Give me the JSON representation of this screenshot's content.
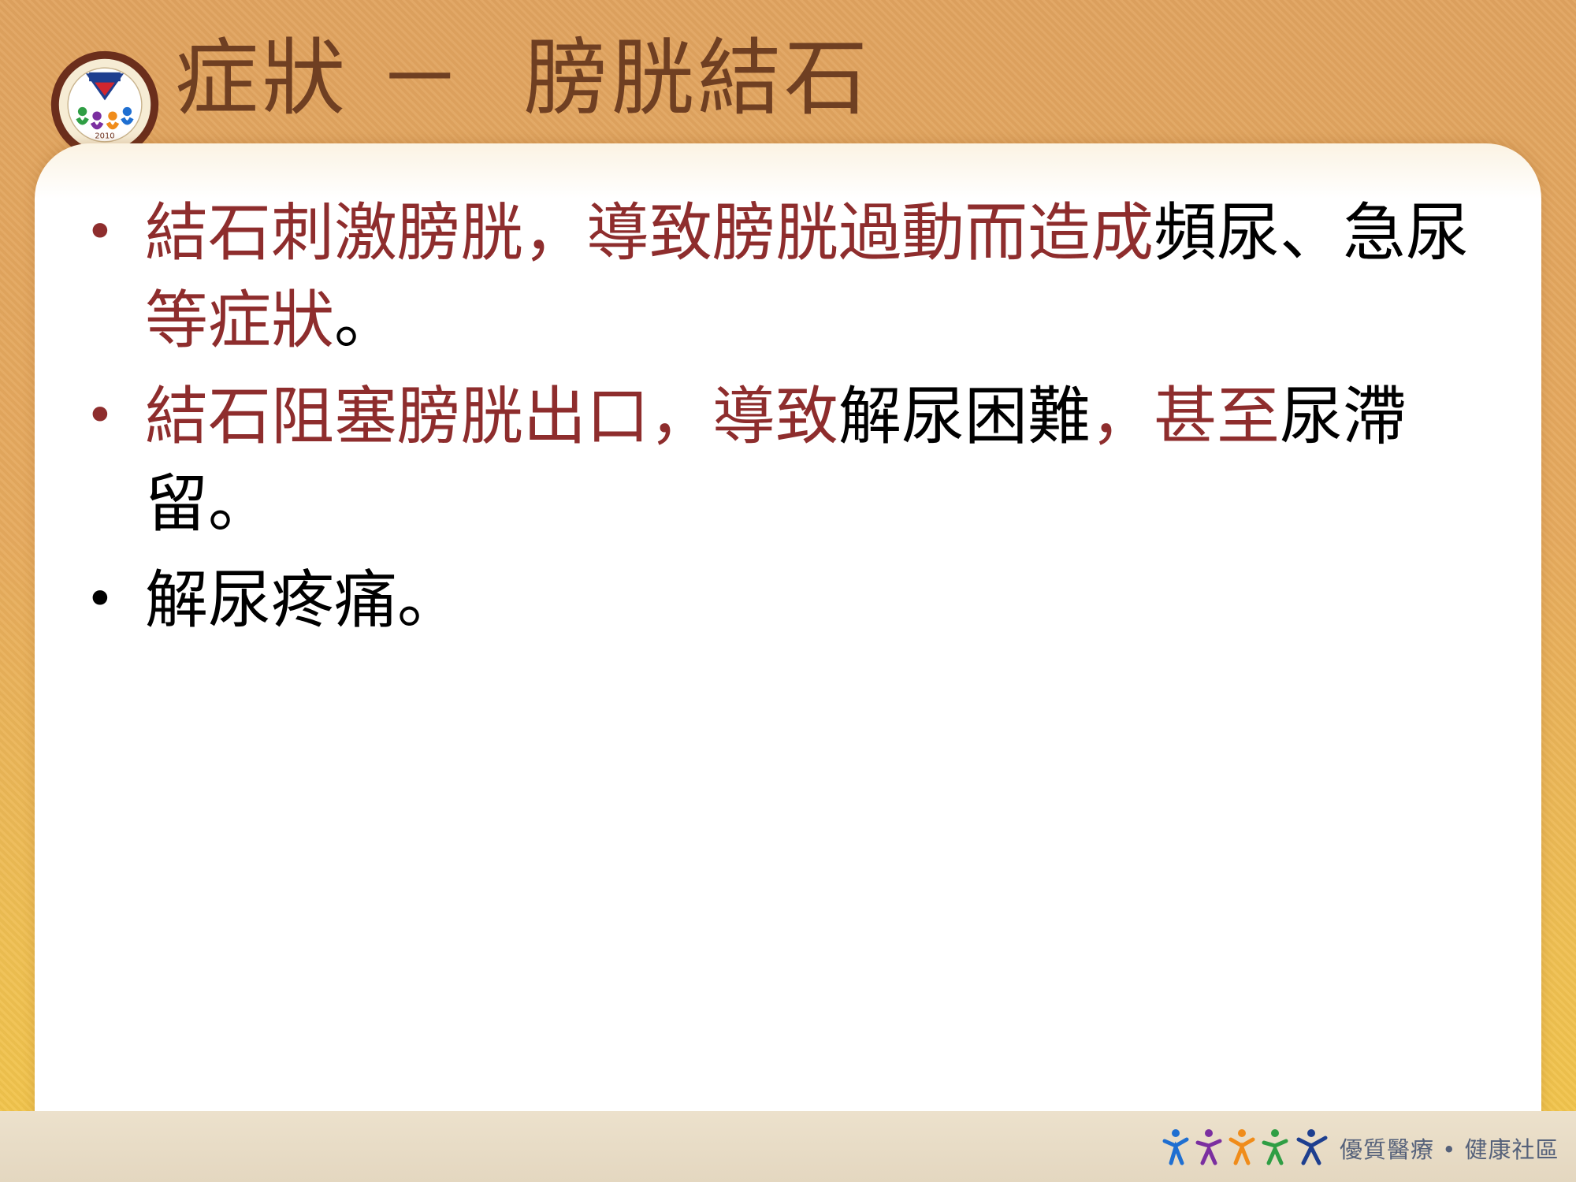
{
  "slide": {
    "title": "症狀 －  膀胱結石",
    "bullets": [
      {
        "segments": [
          {
            "text": "結石刺激膀胱，導致膀胱過動而造成",
            "color": "red"
          },
          {
            "text": "頻尿、急尿",
            "color": "black"
          },
          {
            "text": "等症狀",
            "color": "red"
          },
          {
            "text": "。",
            "color": "black"
          }
        ]
      },
      {
        "segments": [
          {
            "text": "結石阻塞膀胱出口，導致",
            "color": "red"
          },
          {
            "text": "解尿困難",
            "color": "black"
          },
          {
            "text": "，甚至",
            "color": "red"
          },
          {
            "text": "尿滯留",
            "color": "black"
          },
          {
            "text": "。",
            "color": "black"
          }
        ]
      },
      {
        "segments": [
          {
            "text": "解尿疼痛。",
            "color": "black"
          }
        ]
      }
    ]
  },
  "footer": {
    "tagline": "優質醫療 • 健康社區"
  },
  "logo": {
    "icon": "hospital-seal-logo",
    "seal_year": "2010"
  },
  "colors": {
    "accent_red": "#8e2d2d",
    "title_brown": "#6f3f22",
    "background_orange": "#e6aa5e"
  }
}
